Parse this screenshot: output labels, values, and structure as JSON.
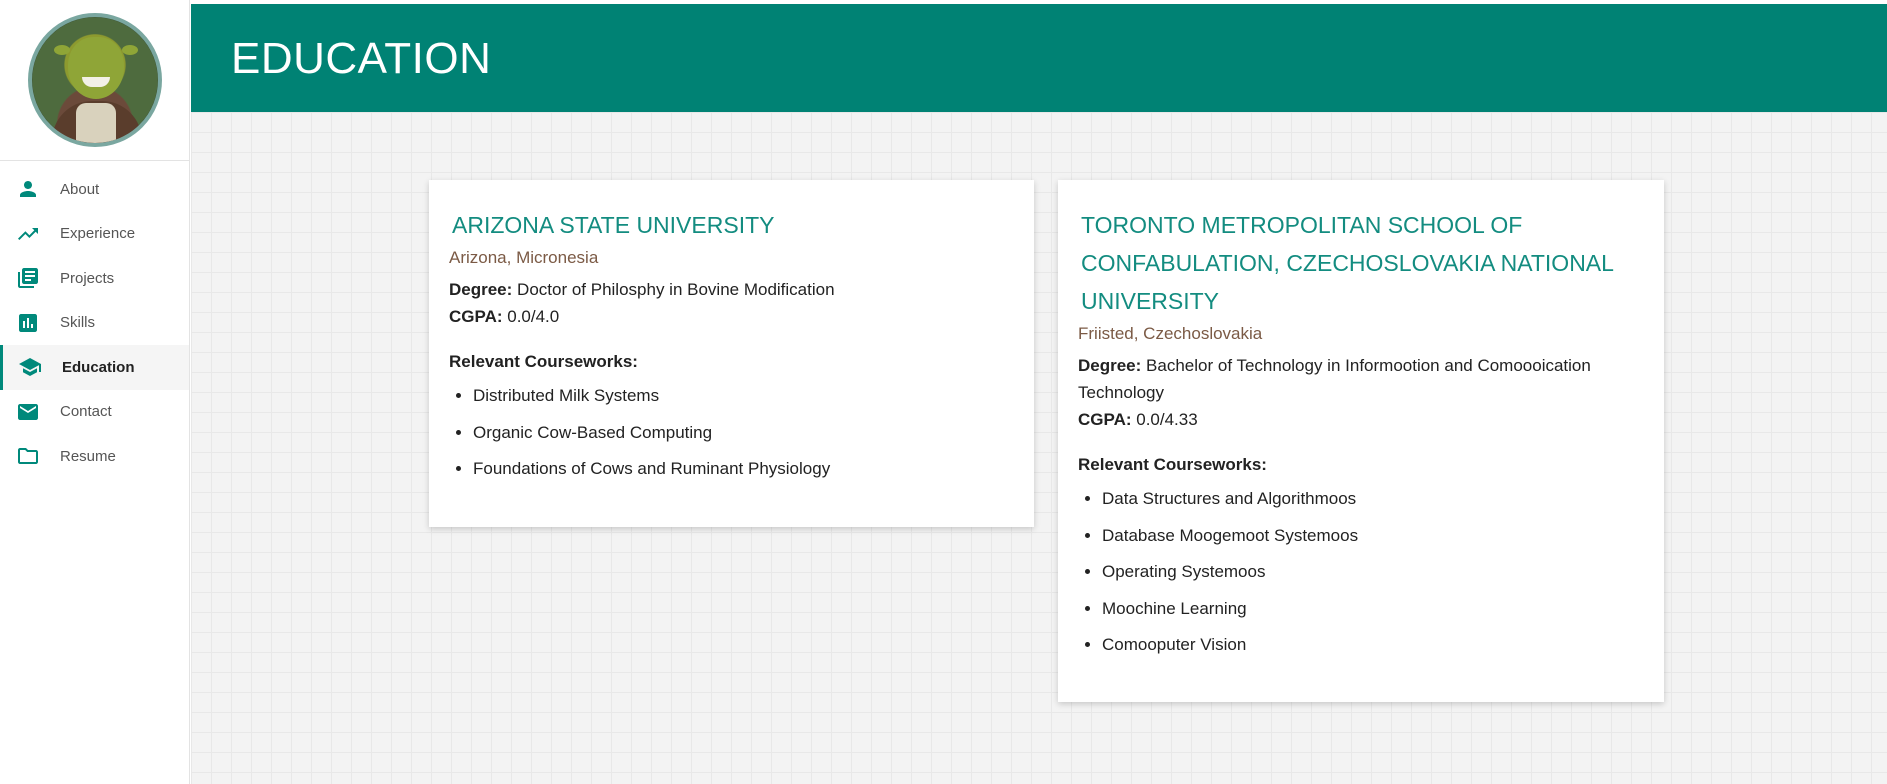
{
  "sidebar": {
    "avatar_icon": "profile-photo",
    "items": [
      {
        "label": "About",
        "icon": "person-icon"
      },
      {
        "label": "Experience",
        "icon": "trending-up-icon"
      },
      {
        "label": "Projects",
        "icon": "library-books-icon"
      },
      {
        "label": "Skills",
        "icon": "bar-chart-icon"
      },
      {
        "label": "Education",
        "icon": "school-icon"
      },
      {
        "label": "Contact",
        "icon": "mail-icon"
      },
      {
        "label": "Resume",
        "icon": "folder-icon"
      }
    ],
    "active": "Education"
  },
  "header": {
    "title": "EDUCATION"
  },
  "colors": {
    "accent": "#008274",
    "university": "#138c80",
    "location": "#7b5a45"
  },
  "education": [
    {
      "university": "ARIZONA STATE UNIVERSITY",
      "location": "Arizona, Micronesia",
      "degree_label": "Degree:",
      "degree": "Doctor of Philosphy in Bovine Modification",
      "cgpa_label": "CGPA:",
      "cgpa": "0.0/4.0",
      "courses_label": "Relevant Courseworks:",
      "courses": [
        "Distributed Milk Systems",
        "Organic Cow-Based Computing",
        "Foundations of Cows and Ruminant Physiology"
      ]
    },
    {
      "university": "TORONTO METROPOLITAN SCHOOL OF CONFABULATION, CZECHOSLOVAKIA NATIONAL UNIVERSITY",
      "location": "Friisted, Czechoslovakia",
      "degree_label": "Degree:",
      "degree": "Bachelor of Technology in Informootion and Comoooication Technology",
      "cgpa_label": "CGPA:",
      "cgpa": "0.0/4.33",
      "courses_label": "Relevant Courseworks:",
      "courses": [
        "Data Structures and Algorithmoos",
        "Database Moogemoot Systemoos",
        "Operating Systemoos",
        "Moochine Learning",
        "Comooputer Vision"
      ]
    }
  ]
}
